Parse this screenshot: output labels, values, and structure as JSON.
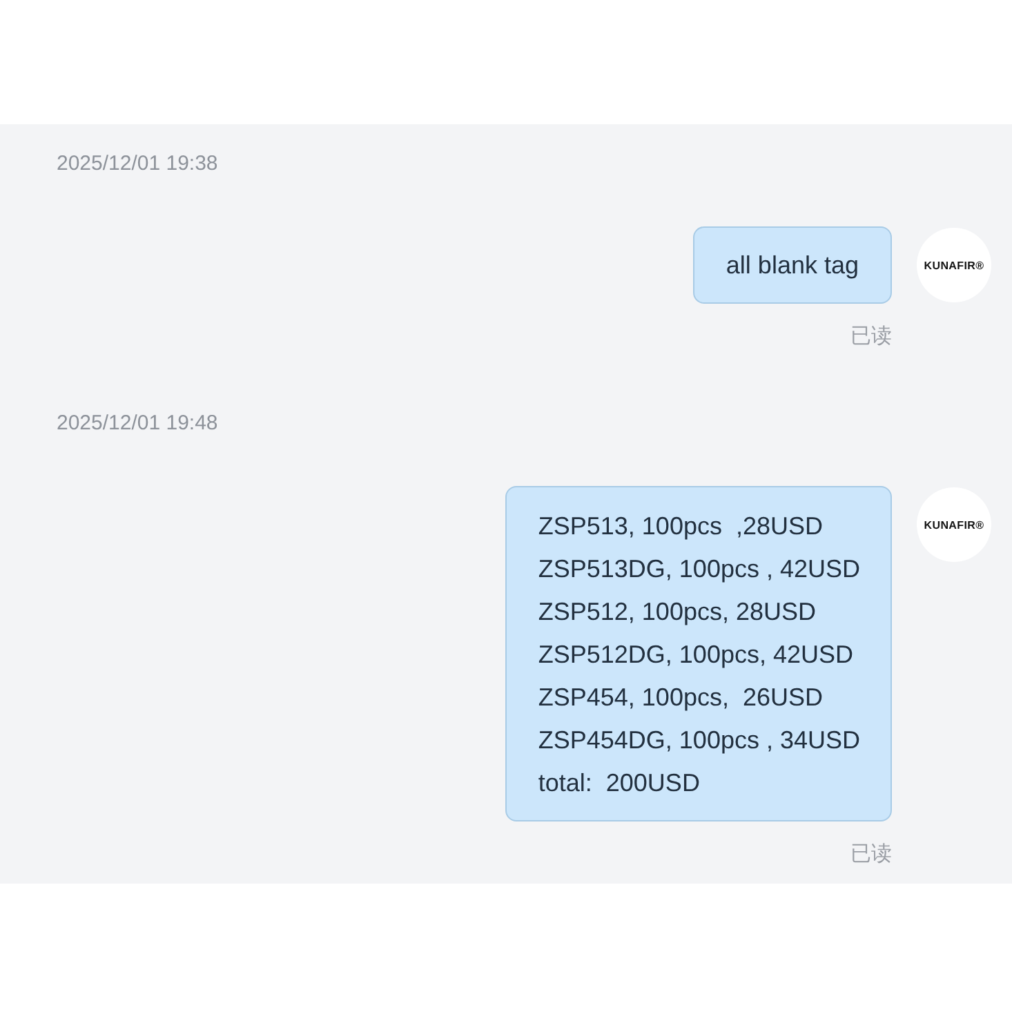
{
  "messages": [
    {
      "timestamp": "2025/12/01 19:38",
      "lines": [
        "all blank tag"
      ],
      "status": "已读",
      "avatar": {
        "logo": "KUNAFIR®"
      }
    },
    {
      "timestamp": "2025/12/01 19:48",
      "lines": [
        "ZSP513, 100pcs  ,28USD",
        "ZSP513DG, 100pcs , 42USD",
        "ZSP512, 100pcs, 28USD",
        "ZSP512DG, 100pcs, 42USD",
        "ZSP454, 100pcs,  26USD",
        "ZSP454DG, 100pcs , 34USD",
        "total:  200USD"
      ],
      "status": "已读",
      "avatar": {
        "logo": "KUNAFIR®"
      }
    }
  ]
}
